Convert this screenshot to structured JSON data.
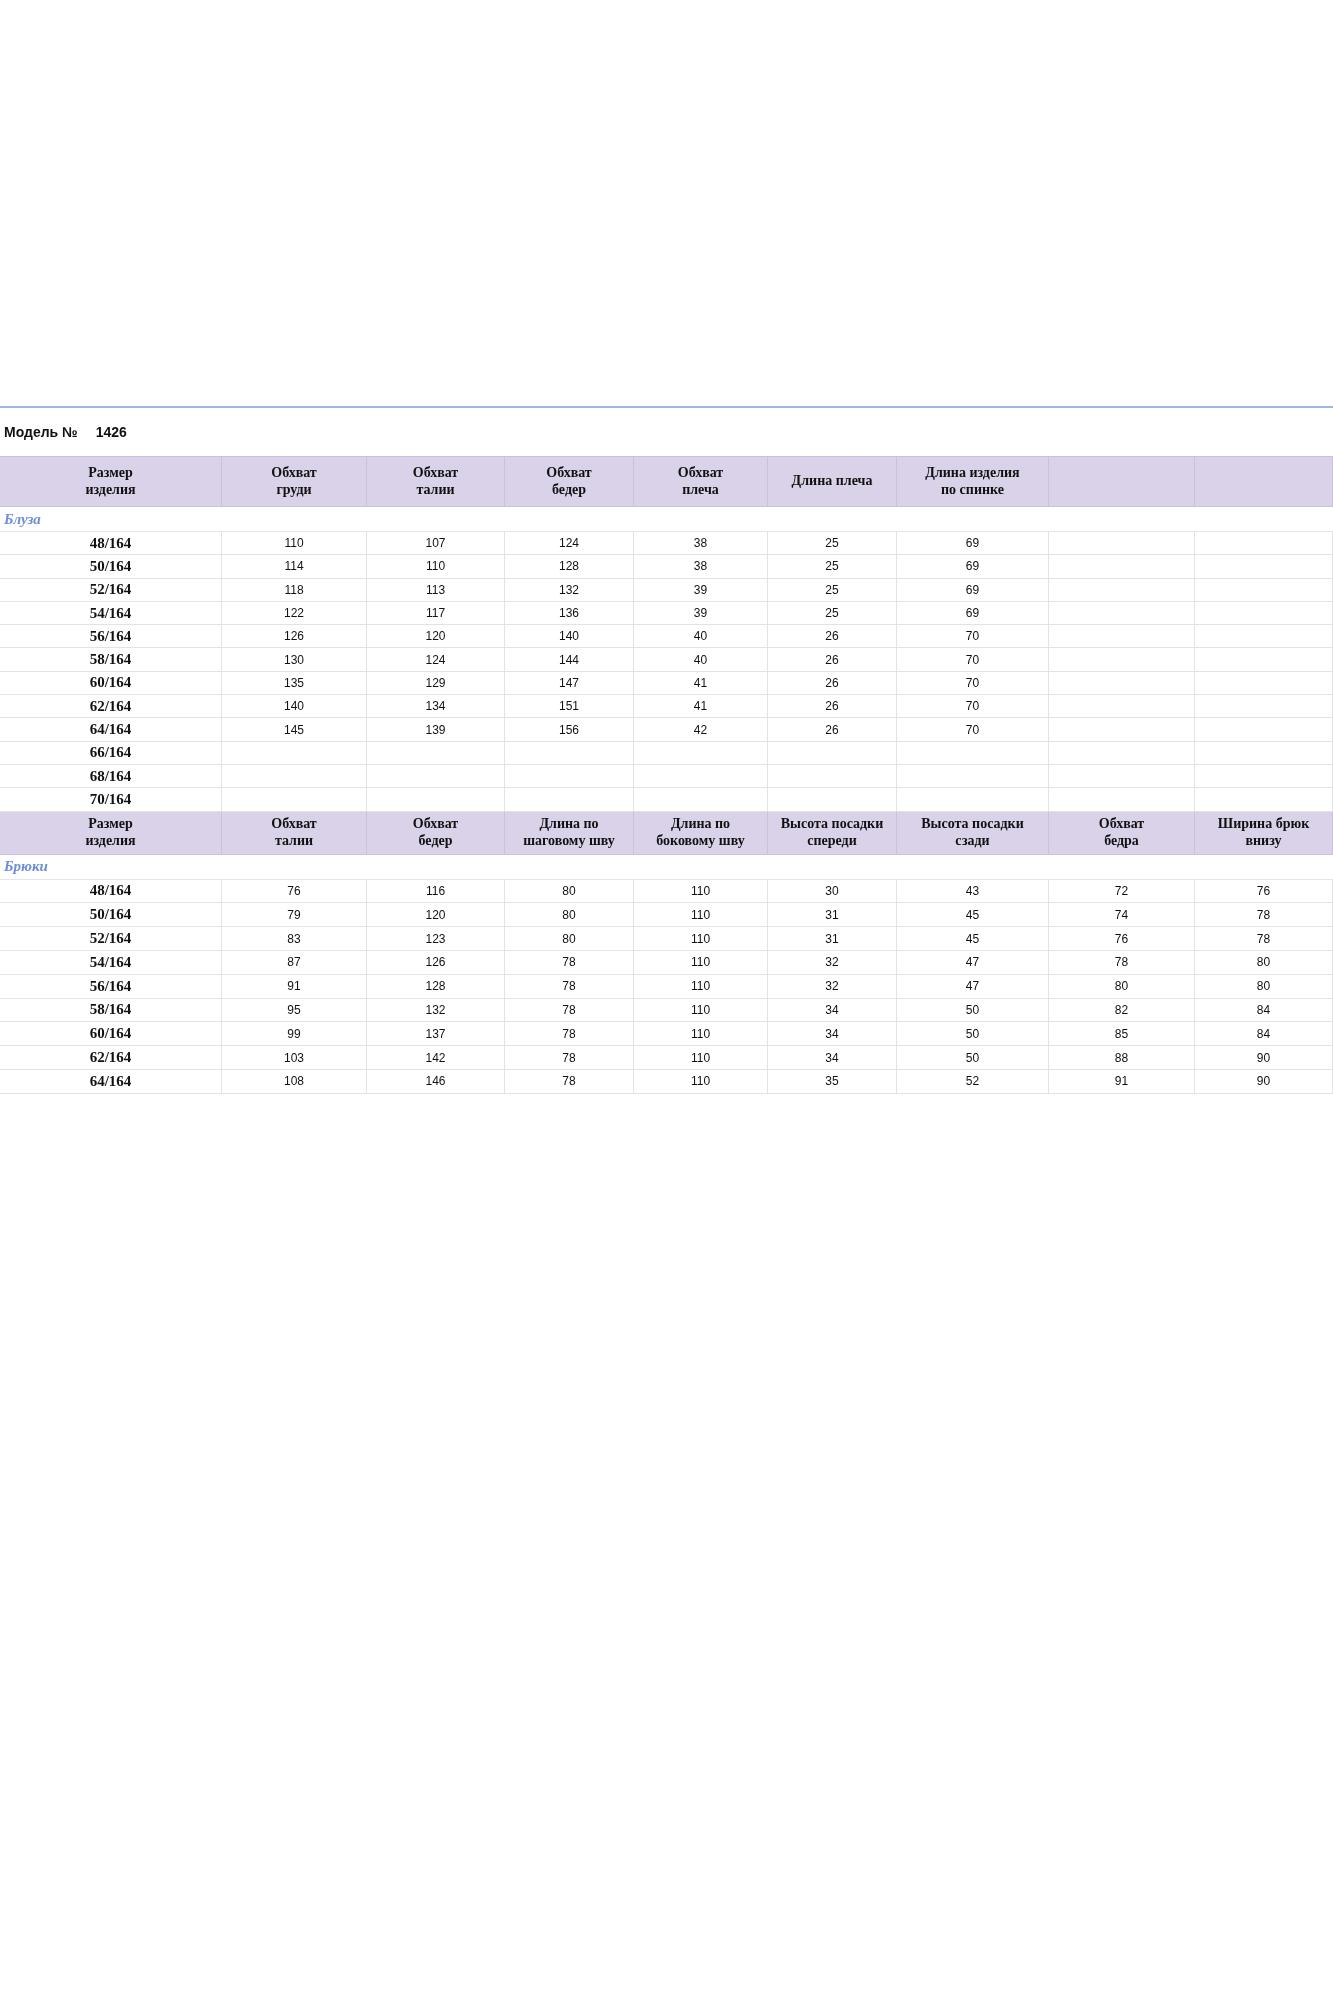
{
  "model_label": "Модель №",
  "model_number": "1426",
  "sections": [
    {
      "columns": [
        "Размер\nизделия",
        "Обхват\nгруди",
        "Обхват\nталии",
        "Обхват\nбедер",
        "Обхват\nплеча",
        "Длина плеча",
        "Длина изделия\nпо спинке"
      ],
      "label": "Блуза",
      "rows": [
        {
          "size": "48/164",
          "values": [
            "110",
            "107",
            "124",
            "38",
            "25",
            "69"
          ]
        },
        {
          "size": "50/164",
          "values": [
            "114",
            "110",
            "128",
            "38",
            "25",
            "69"
          ]
        },
        {
          "size": "52/164",
          "values": [
            "118",
            "113",
            "132",
            "39",
            "25",
            "69"
          ]
        },
        {
          "size": "54/164",
          "values": [
            "122",
            "117",
            "136",
            "39",
            "25",
            "69"
          ]
        },
        {
          "size": "56/164",
          "values": [
            "126",
            "120",
            "140",
            "40",
            "26",
            "70"
          ]
        },
        {
          "size": "58/164",
          "values": [
            "130",
            "124",
            "144",
            "40",
            "26",
            "70"
          ]
        },
        {
          "size": "60/164",
          "values": [
            "135",
            "129",
            "147",
            "41",
            "26",
            "70"
          ]
        },
        {
          "size": "62/164",
          "values": [
            "140",
            "134",
            "151",
            "41",
            "26",
            "70"
          ]
        },
        {
          "size": "64/164",
          "values": [
            "145",
            "139",
            "156",
            "42",
            "26",
            "70"
          ]
        },
        {
          "size": "66/164",
          "values": []
        },
        {
          "size": "68/164",
          "values": []
        },
        {
          "size": "70/164",
          "values": []
        }
      ]
    },
    {
      "columns": [
        "Размер\nизделия",
        "Обхват\nталии",
        "Обхват\nбедер",
        "Длина по\nшаговому шву",
        "Длина по\nбоковому шву",
        "Высота посадки\nспереди",
        "Высота посадки\nсзади",
        "Обхват\nбедра",
        "Ширина брюк\nвнизу"
      ],
      "label": "Брюки",
      "rows": [
        {
          "size": "48/164",
          "values": [
            "76",
            "116",
            "80",
            "110",
            "30",
            "43",
            "72",
            "76"
          ]
        },
        {
          "size": "50/164",
          "values": [
            "79",
            "120",
            "80",
            "110",
            "31",
            "45",
            "74",
            "78"
          ]
        },
        {
          "size": "52/164",
          "values": [
            "83",
            "123",
            "80",
            "110",
            "31",
            "45",
            "76",
            "78"
          ]
        },
        {
          "size": "54/164",
          "values": [
            "87",
            "126",
            "78",
            "110",
            "32",
            "47",
            "78",
            "80"
          ]
        },
        {
          "size": "56/164",
          "values": [
            "91",
            "128",
            "78",
            "110",
            "32",
            "47",
            "80",
            "80"
          ]
        },
        {
          "size": "58/164",
          "values": [
            "95",
            "132",
            "78",
            "110",
            "34",
            "50",
            "82",
            "84"
          ]
        },
        {
          "size": "60/164",
          "values": [
            "99",
            "137",
            "78",
            "110",
            "34",
            "50",
            "85",
            "84"
          ]
        },
        {
          "size": "62/164",
          "values": [
            "103",
            "142",
            "78",
            "110",
            "34",
            "50",
            "88",
            "90"
          ]
        },
        {
          "size": "64/164",
          "values": [
            "108",
            "146",
            "78",
            "110",
            "35",
            "52",
            "91",
            "90"
          ]
        }
      ]
    }
  ]
}
